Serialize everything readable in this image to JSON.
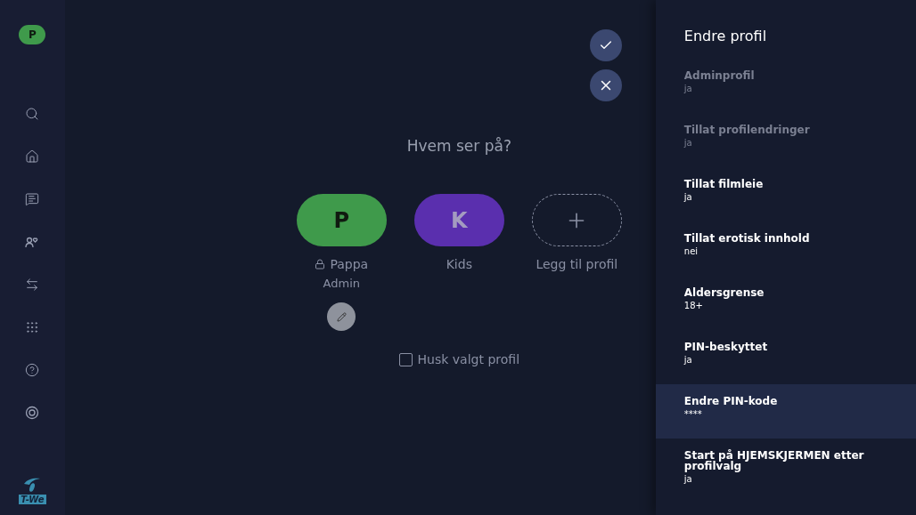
{
  "sidebar": {
    "avatar": {
      "initial": "P",
      "color": "#3f9a4b"
    },
    "items": [
      {
        "kind": "search",
        "selected": false
      },
      {
        "kind": "home",
        "selected": false
      },
      {
        "kind": "messages",
        "selected": false
      },
      {
        "kind": "favorites",
        "selected": false
      },
      {
        "kind": "switch",
        "selected": false
      },
      {
        "kind": "apps",
        "selected": false
      },
      {
        "kind": "help",
        "selected": false
      },
      {
        "kind": "settings",
        "selected": false
      }
    ],
    "logo": {
      "text": "T-We"
    }
  },
  "main": {
    "heading": "Hvem ser på?",
    "profiles": [
      {
        "kind": "profile",
        "initial": "P",
        "name": "Pappa",
        "subtitle": "Admin",
        "color": "#3f9a4b",
        "locked": true,
        "editable": true
      },
      {
        "kind": "profile",
        "initial": "K",
        "name": "Kids",
        "color": "#5a2fae",
        "locked": false,
        "editable": false
      },
      {
        "kind": "add",
        "name": "Legg til profil"
      }
    ],
    "remember": {
      "label": "Husk valgt profil",
      "checked": false
    }
  },
  "panel": {
    "title": "Endre profil",
    "items": [
      {
        "label": "Adminprofil",
        "value": "ja",
        "disabled": true,
        "selected": false
      },
      {
        "label": "Tillat profilendringer",
        "value": "ja",
        "disabled": true,
        "selected": false
      },
      {
        "label": "Tillat filmleie",
        "value": "ja",
        "disabled": false,
        "selected": false
      },
      {
        "label": "Tillat erotisk innhold",
        "value": "nei",
        "disabled": false,
        "selected": false
      },
      {
        "label": "Aldersgrense",
        "value": "18+",
        "disabled": false,
        "selected": false
      },
      {
        "label": "PIN-beskyttet",
        "value": "ja",
        "disabled": false,
        "selected": false
      },
      {
        "label": "Endre PIN-kode",
        "value": "****",
        "disabled": false,
        "selected": true
      },
      {
        "label": "Start på HJEMSKJERMEN etter profilvalg",
        "value": "ja",
        "disabled": false,
        "selected": false
      }
    ]
  }
}
